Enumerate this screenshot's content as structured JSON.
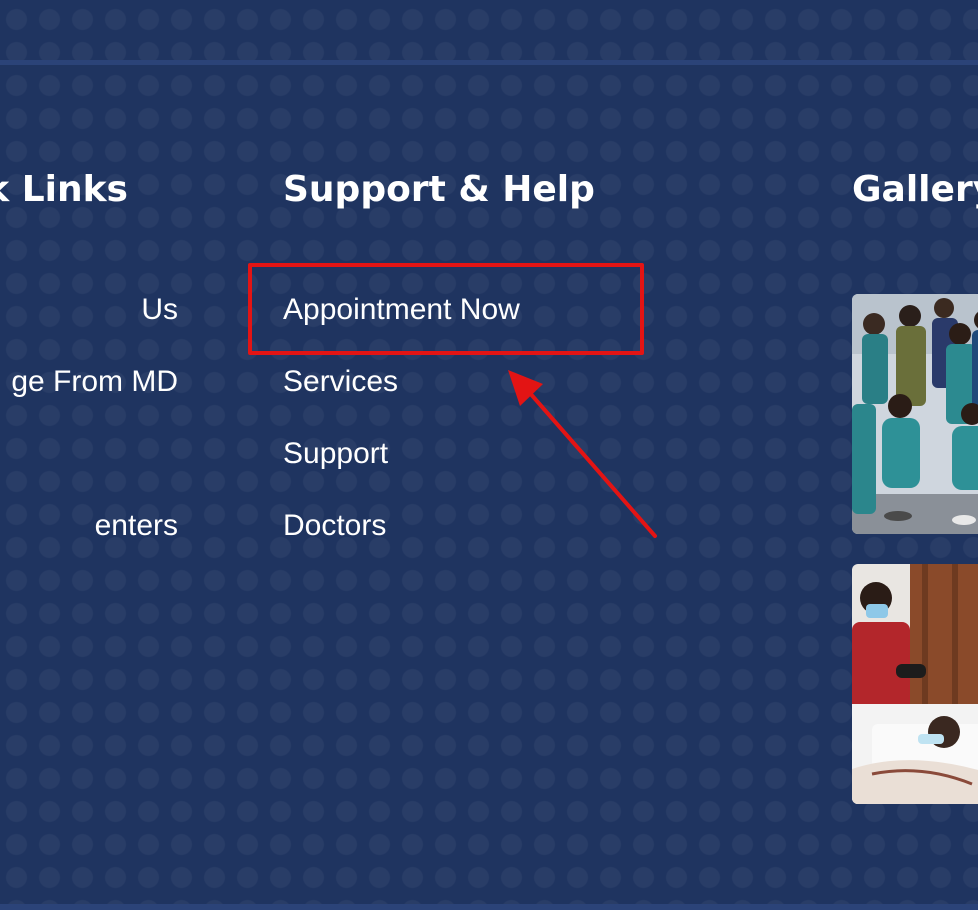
{
  "quick_links": {
    "heading": "k Links",
    "items": [
      {
        "label": "Us"
      },
      {
        "label": "ge From MD"
      },
      {
        "label": "enters"
      }
    ]
  },
  "support_help": {
    "heading": "Support & Help",
    "items": [
      {
        "label": "Appointment Now"
      },
      {
        "label": "Services"
      },
      {
        "label": "Support"
      },
      {
        "label": "Doctors"
      }
    ]
  },
  "gallery": {
    "heading": "Gallery",
    "images": [
      {
        "subject": "group of nurses in teal uniforms"
      },
      {
        "subject": "doctor attending patient in hospital bed"
      }
    ]
  },
  "annotation": {
    "box_color": "#e31414",
    "arrow_color": "#e31414"
  },
  "colors": {
    "background": "#1f3460",
    "rule": "#2b4378",
    "text": "#ffffff"
  }
}
